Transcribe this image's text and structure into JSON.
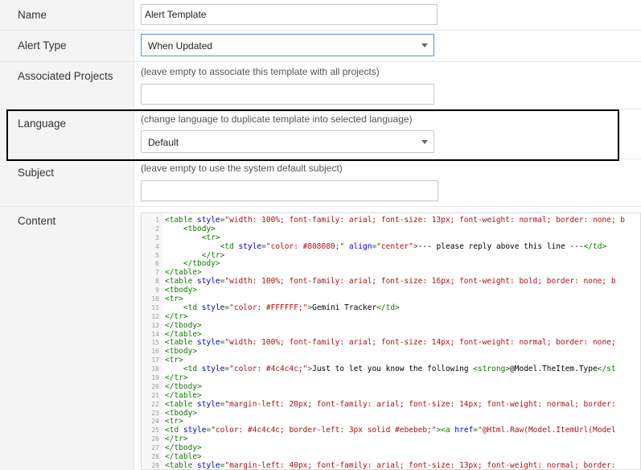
{
  "form": {
    "name": {
      "label": "Name",
      "value": "Alert Template"
    },
    "alert_type": {
      "label": "Alert Type",
      "selected": "When Updated"
    },
    "associated_projects": {
      "label": "Associated Projects",
      "hint": "(leave empty to associate this template with all projects)",
      "value": ""
    },
    "language": {
      "label": "Language",
      "hint": "(change language to duplicate template into selected language)",
      "selected": "Default"
    },
    "subject": {
      "label": "Subject",
      "hint": "(leave empty to use the system default subject)",
      "value": ""
    },
    "content": {
      "label": "Content"
    }
  },
  "code": [
    {
      "n": "1",
      "segs": [
        [
          "tag",
          "<table "
        ],
        [
          "attr",
          "style"
        ],
        [
          "tag",
          "="
        ],
        [
          "str",
          "\"width: 100%; font-family: arial; font-size: 13px; font-weight: normal; border: none; b"
        ]
      ]
    },
    {
      "n": "2",
      "segs": [
        [
          "txt",
          "    "
        ],
        [
          "tag",
          "<tbody>"
        ]
      ]
    },
    {
      "n": "3",
      "segs": [
        [
          "txt",
          "        "
        ],
        [
          "tag",
          "<tr>"
        ]
      ]
    },
    {
      "n": "4",
      "segs": [
        [
          "txt",
          "            "
        ],
        [
          "tag",
          "<td "
        ],
        [
          "attr",
          "style"
        ],
        [
          "tag",
          "="
        ],
        [
          "str",
          "\"color: #808080;\" "
        ],
        [
          "attr",
          "align"
        ],
        [
          "tag",
          "="
        ],
        [
          "str",
          "\"center\""
        ],
        [
          "tag",
          ">"
        ],
        [
          "txt",
          "--- please reply above this line ---"
        ],
        [
          "tag",
          "</td>"
        ]
      ]
    },
    {
      "n": "5",
      "segs": [
        [
          "txt",
          "        "
        ],
        [
          "tag",
          "</tr>"
        ]
      ]
    },
    {
      "n": "6",
      "segs": [
        [
          "txt",
          "    "
        ],
        [
          "tag",
          "</tbody>"
        ]
      ]
    },
    {
      "n": "7",
      "segs": [
        [
          "tag",
          "</table>"
        ]
      ]
    },
    {
      "n": "8",
      "segs": [
        [
          "tag",
          "<table "
        ],
        [
          "attr",
          "style"
        ],
        [
          "tag",
          "="
        ],
        [
          "str",
          "\"width: 100%; font-family: arial; font-size: 16px; font-weight: bold; border: none; b"
        ]
      ]
    },
    {
      "n": "9",
      "segs": [
        [
          "tag",
          "<tbody>"
        ]
      ]
    },
    {
      "n": "10",
      "segs": [
        [
          "tag",
          "<tr>"
        ]
      ]
    },
    {
      "n": "11",
      "segs": [
        [
          "txt",
          "    "
        ],
        [
          "tag",
          "<td "
        ],
        [
          "attr",
          "style"
        ],
        [
          "tag",
          "="
        ],
        [
          "str",
          "\"color: #FFFFFF;\""
        ],
        [
          "tag",
          ">"
        ],
        [
          "txt",
          "Gemini Tracker"
        ],
        [
          "tag",
          "</td>"
        ]
      ]
    },
    {
      "n": "12",
      "segs": [
        [
          "tag",
          "</tr>"
        ]
      ]
    },
    {
      "n": "13",
      "segs": [
        [
          "tag",
          "</tbody>"
        ]
      ]
    },
    {
      "n": "14",
      "segs": [
        [
          "tag",
          "</table>"
        ]
      ]
    },
    {
      "n": "15",
      "segs": [
        [
          "tag",
          "<table "
        ],
        [
          "attr",
          "style"
        ],
        [
          "tag",
          "="
        ],
        [
          "str",
          "\"width: 100%; font-family: arial; font-size: 14px; font-weight: normal; border: none;"
        ]
      ]
    },
    {
      "n": "16",
      "segs": [
        [
          "tag",
          "<tbody>"
        ]
      ]
    },
    {
      "n": "17",
      "segs": [
        [
          "tag",
          "<tr>"
        ]
      ]
    },
    {
      "n": "18",
      "segs": [
        [
          "txt",
          "    "
        ],
        [
          "tag",
          "<td "
        ],
        [
          "attr",
          "style"
        ],
        [
          "tag",
          "="
        ],
        [
          "str",
          "\"color: #4c4c4c;\""
        ],
        [
          "tag",
          ">"
        ],
        [
          "txt",
          "Just to let you know the following "
        ],
        [
          "tag",
          "<strong>"
        ],
        [
          "txt",
          "@Model.TheItem.Type"
        ],
        [
          "tag",
          "</st"
        ]
      ]
    },
    {
      "n": "19",
      "segs": [
        [
          "tag",
          "</tr>"
        ]
      ]
    },
    {
      "n": "20",
      "segs": [
        [
          "tag",
          "</tbody>"
        ]
      ]
    },
    {
      "n": "21",
      "segs": [
        [
          "tag",
          "</table>"
        ]
      ]
    },
    {
      "n": "22",
      "segs": [
        [
          "tag",
          "<table "
        ],
        [
          "attr",
          "style"
        ],
        [
          "tag",
          "="
        ],
        [
          "str",
          "\"margin-left: 20px; font-family: arial; font-size: 14px; font-weight: normal; border:"
        ]
      ]
    },
    {
      "n": "23",
      "segs": [
        [
          "tag",
          "<tbody>"
        ]
      ]
    },
    {
      "n": "24",
      "segs": [
        [
          "tag",
          "<tr>"
        ]
      ]
    },
    {
      "n": "25",
      "segs": [
        [
          "tag",
          "<td "
        ],
        [
          "attr",
          "style"
        ],
        [
          "tag",
          "="
        ],
        [
          "str",
          "\"color: #4c4c4c; border-left: 3px solid #ebebeb;\""
        ],
        [
          "tag",
          ">"
        ],
        [
          "tag",
          "<a "
        ],
        [
          "attr",
          "href"
        ],
        [
          "tag",
          "="
        ],
        [
          "str",
          "\"@Html.Raw(Model.ItemUrl(Model"
        ]
      ]
    },
    {
      "n": "26",
      "segs": [
        [
          "tag",
          "</tr>"
        ]
      ]
    },
    {
      "n": "27",
      "segs": [
        [
          "tag",
          "</tbody>"
        ]
      ]
    },
    {
      "n": "28",
      "segs": [
        [
          "tag",
          "</table>"
        ]
      ]
    },
    {
      "n": "29",
      "segs": [
        [
          "tag",
          "<table "
        ],
        [
          "attr",
          "style"
        ],
        [
          "tag",
          "="
        ],
        [
          "str",
          "\"margin-left: 40px; font-family: arial; font-size: 13px; font-weight: normal; border:"
        ]
      ]
    }
  ]
}
